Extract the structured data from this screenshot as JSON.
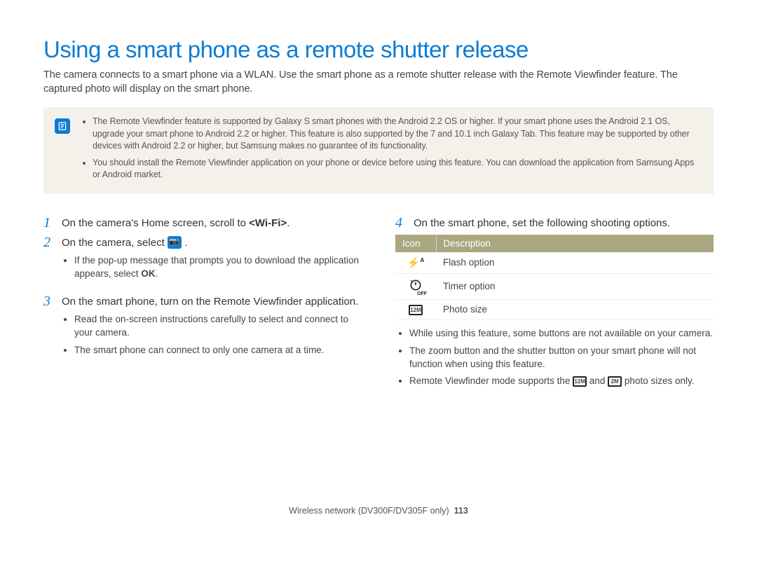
{
  "title": "Using a smart phone as a remote shutter release",
  "intro": "The camera connects to a smart phone via a WLAN. Use the smart phone as a remote shutter release with the Remote Viewfinder feature. The captured photo will display on the smart phone.",
  "note": {
    "bullet1": "The Remote Viewfinder feature is supported by Galaxy S smart phones with the Android 2.2 OS or higher. If your smart phone uses the Android 2.1 OS, upgrade your smart phone to Android 2.2 or higher. This feature is also supported by the 7 and 10.1 inch Galaxy Tab. This feature may be supported by other devices with Android 2.2 or higher, but Samsung makes no guarantee of its functionality.",
    "bullet2": "You should install the Remote Viewfinder application on your phone or device before using this feature. You can download the application from Samsung Apps or Android market."
  },
  "steps": {
    "s1": {
      "num": "1",
      "text_pre": "On the camera's Home screen, scroll to ",
      "text_bold": "<Wi-Fi>",
      "text_post": "."
    },
    "s2": {
      "num": "2",
      "text_pre": "On the camera, select ",
      "text_post": "."
    },
    "s2_sub1_pre": "If the pop-up message that prompts you to download the application appears, select ",
    "s2_sub1_bold": "OK",
    "s2_sub1_post": ".",
    "s3": {
      "num": "3",
      "text": "On the smart phone, turn on the Remote Viewfinder application."
    },
    "s3_sub1": "Read the on-screen instructions carefully to select and connect to your camera.",
    "s3_sub2": "The smart phone can connect to only one camera at a time.",
    "s4": {
      "num": "4",
      "text": "On the smart phone, set the following shooting options."
    },
    "s4_sub1": "While using this feature, some buttons are not available on your camera.",
    "s4_sub2": "The zoom button and the shutter button on your smart phone will not function when using this feature.",
    "s4_sub3_pre": "Remote Viewfinder mode supports the ",
    "s4_sub3_mid": " and ",
    "s4_sub3_post": " photo sizes only."
  },
  "table": {
    "head_icon": "Icon",
    "head_desc": "Description",
    "row1": {
      "icon_label": "flash-auto-icon",
      "desc": "Flash option"
    },
    "row2": {
      "icon_label": "timer-off-icon",
      "desc": "Timer option"
    },
    "row3": {
      "icon_label": "photo-size-12m-icon",
      "desc": "Photo size"
    }
  },
  "footer": {
    "section": "Wireless network (DV300F/DV305F only)",
    "page": "113"
  }
}
